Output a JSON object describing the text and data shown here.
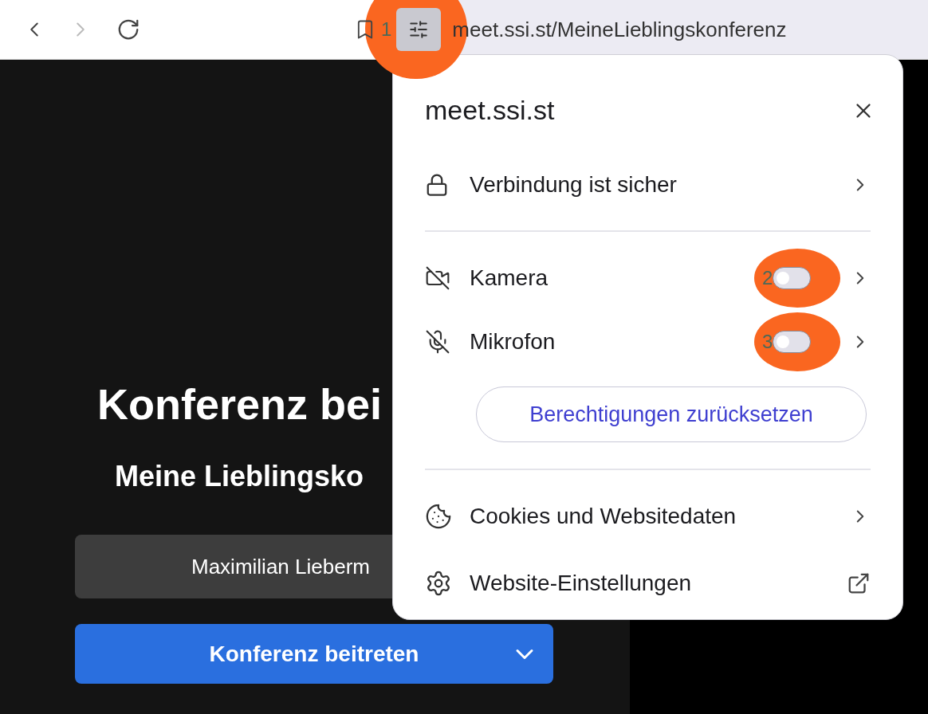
{
  "toolbar": {
    "marker": "1",
    "url": "meet.ssi.st/MeineLieblingskonferenz"
  },
  "page": {
    "heading": "Konferenz bei",
    "subtitle": "Meine Lieblingsko",
    "name_field": "Maximilian Lieberm",
    "join_button": "Konferenz beitreten"
  },
  "popup": {
    "title": "meet.ssi.st",
    "connection": "Verbindung ist sicher",
    "permissions": [
      {
        "kind": "camera",
        "label": "Kamera",
        "on": false,
        "marker": "2"
      },
      {
        "kind": "mic",
        "label": "Mikrofon",
        "on": false,
        "marker": "3"
      }
    ],
    "reset_button": "Berechtigungen zurücksetzen",
    "links": [
      {
        "kind": "cookies",
        "label": "Cookies und Websitedaten"
      },
      {
        "kind": "settings",
        "label": "Website-Einstellungen"
      }
    ]
  }
}
